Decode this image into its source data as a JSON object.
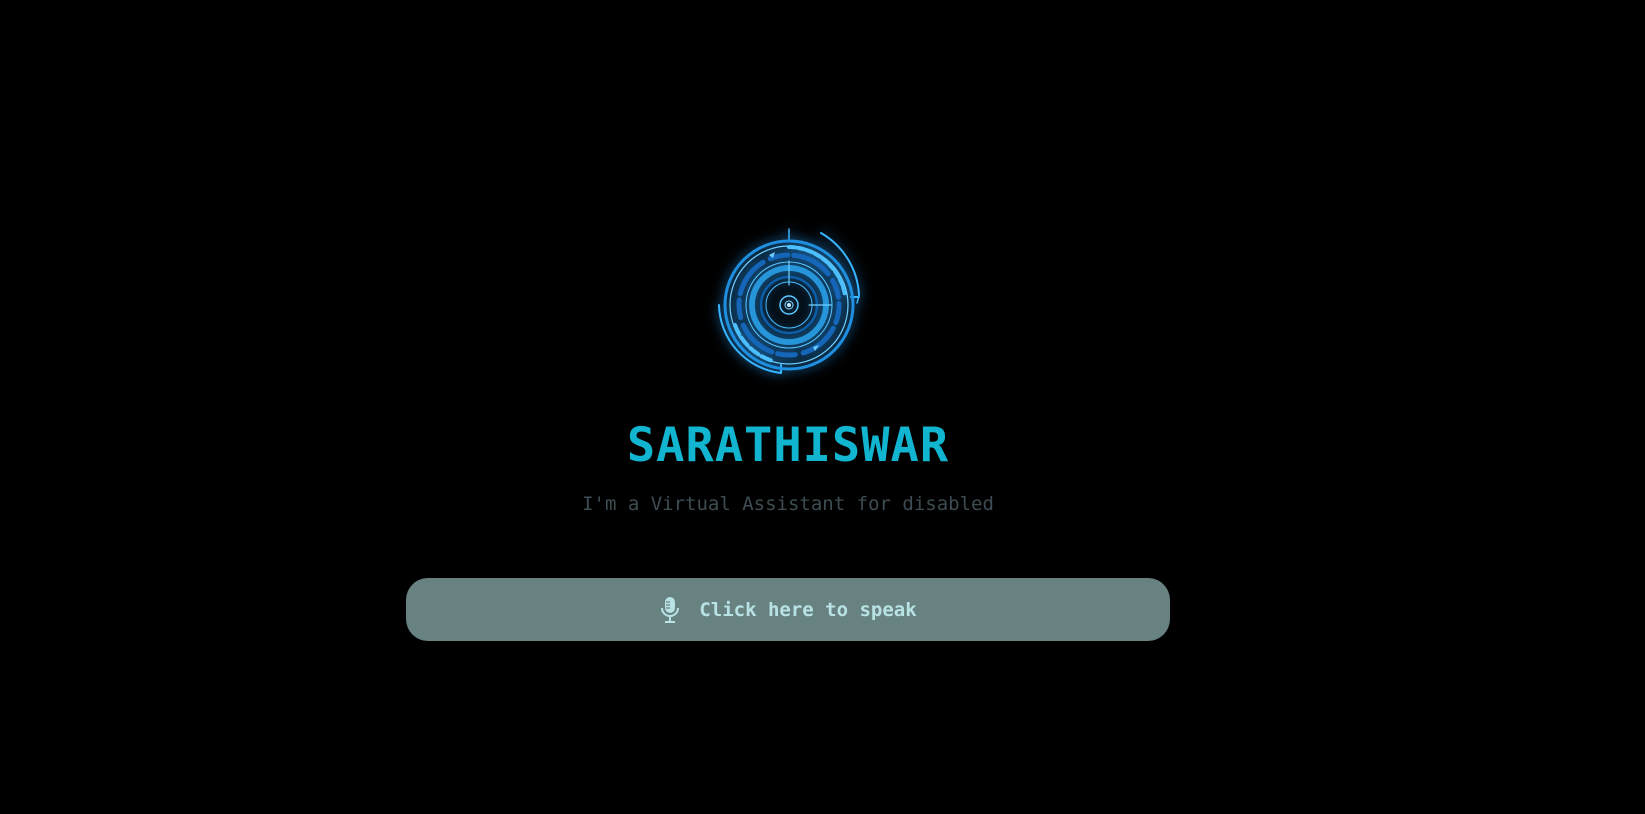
{
  "assistant": {
    "name": "SARATHISWAR",
    "tagline": "I'm a Virtual Assistant for disabled"
  },
  "speak_button": {
    "label": "Click here to speak",
    "icon": "microphone-icon"
  },
  "logo": {
    "icon": "hud-circle-icon"
  },
  "colors": {
    "background": "#000000",
    "accent": "#12b5d0",
    "subtitle": "#3d4c52",
    "button_bg": "#678281",
    "button_text": "#b8e2e4",
    "logo_glow": "#28a0ff"
  }
}
